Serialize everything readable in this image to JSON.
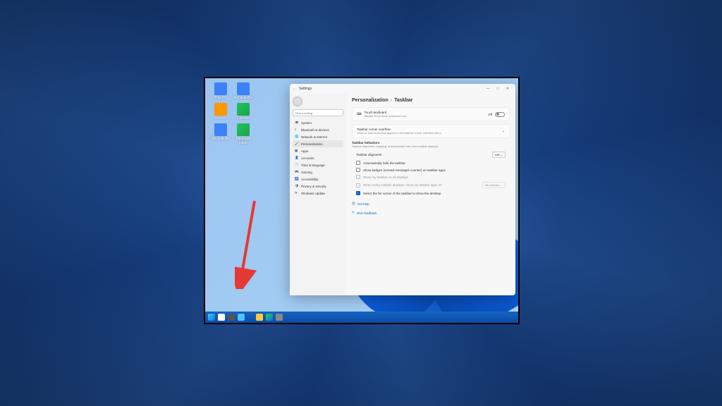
{
  "desktop_icons": [
    {
      "label": "This PC",
      "color": "blu"
    },
    {
      "label": "Recycle Bin",
      "color": "blu"
    },
    {
      "label": "Firefox",
      "color": "ora"
    },
    {
      "label": "Chrome",
      "color": "grn"
    },
    {
      "label": "Recycle Bin",
      "color": "blu"
    },
    {
      "label": "Microsoft Edge",
      "color": "grn"
    }
  ],
  "window": {
    "title": "Settings",
    "back": "←",
    "min": "—",
    "max": "□",
    "close": "✕",
    "search_placeholder": "Find a setting"
  },
  "nav": [
    {
      "icon": "💻",
      "label": "System"
    },
    {
      "icon": "ᛒ",
      "label": "Bluetooth & devices"
    },
    {
      "icon": "🌐",
      "label": "Network & internet"
    },
    {
      "icon": "🖌",
      "label": "Personalization",
      "selected": true
    },
    {
      "icon": "▦",
      "label": "Apps"
    },
    {
      "icon": "👤",
      "label": "Accounts"
    },
    {
      "icon": "🕐",
      "label": "Time & language"
    },
    {
      "icon": "🎮",
      "label": "Gaming"
    },
    {
      "icon": "♿",
      "label": "Accessibility"
    },
    {
      "icon": "🛡",
      "label": "Privacy & security"
    },
    {
      "icon": "⟳",
      "label": "Windows Update"
    }
  ],
  "breadcrumb": {
    "a": "Personalization",
    "b": "Taskbar"
  },
  "touch": {
    "title": "Touch keyboard",
    "sub": "Always show touch keyboard icon",
    "state": "Off"
  },
  "overflow": {
    "title": "Taskbar corner overflow",
    "sub": "Show or hide icons that appear in the taskbar corner overflow menu"
  },
  "behaviors": {
    "title": "Taskbar behaviors",
    "sub": "Taskbar alignment, badging, automatically hide, and multiple displays",
    "alignment_label": "Taskbar alignment",
    "alignment_value": "Left",
    "opts": [
      {
        "label": "Automatically hide the taskbar",
        "checked": false
      },
      {
        "label": "Show badges (unread messages counter) on taskbar apps",
        "checked": false
      },
      {
        "label": "Show my taskbar on all displays",
        "checked": false,
        "disabled": true
      },
      {
        "label": "When using multiple displays, show my taskbar apps on",
        "checked": false,
        "disabled": true,
        "dd": "All taskbars"
      },
      {
        "label": "Select the far corner of the taskbar to show the desktop",
        "checked": true
      }
    ]
  },
  "help": {
    "a": "Get help",
    "b": "Give feedback"
  }
}
